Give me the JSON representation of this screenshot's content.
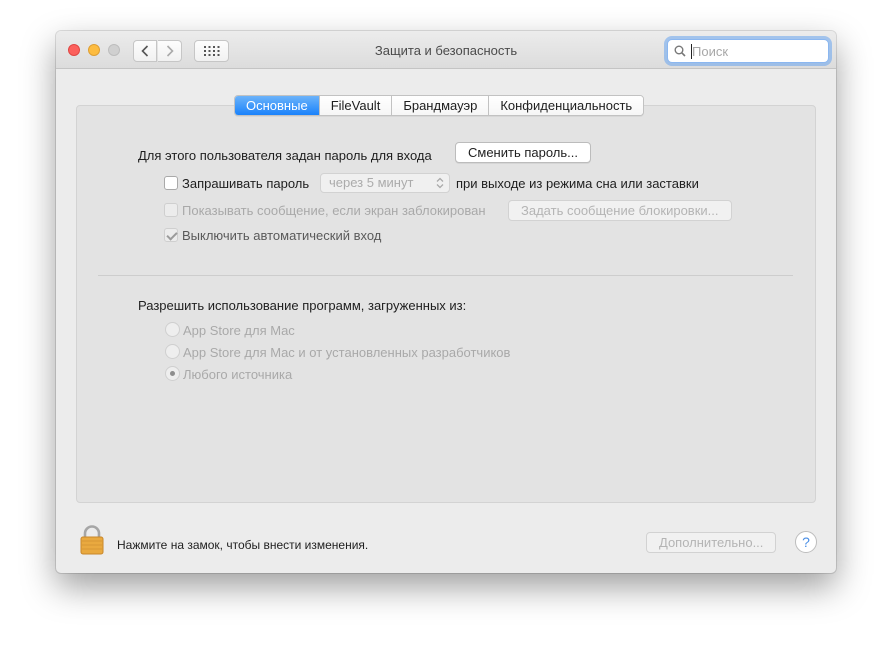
{
  "window": {
    "title": "Защита и безопасность",
    "search_placeholder": "Поиск"
  },
  "tabs": [
    {
      "label": "Основные",
      "active": true
    },
    {
      "label": "FileVault",
      "active": false
    },
    {
      "label": "Брандмауэр",
      "active": false
    },
    {
      "label": "Конфиденциальность",
      "active": false
    }
  ],
  "general": {
    "password_set_label": "Для этого пользователя задан пароль для входа",
    "change_password_button": "Сменить пароль...",
    "require_password": {
      "label": "Запрашивать пароль",
      "checked": false,
      "delay": "через 5 минут",
      "suffix": "при выходе из режима сна или заставки"
    },
    "show_message": {
      "label": "Показывать сообщение, если экран заблокирован",
      "checked": false,
      "disabled": true,
      "button": "Задать сообщение блокировки..."
    },
    "disable_autologin": {
      "label": "Выключить автоматический вход",
      "checked": true,
      "disabled": true
    }
  },
  "allow_apps": {
    "heading": "Разрешить использование программ, загруженных из:",
    "options": [
      {
        "label": "App Store для Mac",
        "selected": false
      },
      {
        "label": "App Store для Mac и от установленных разработчиков",
        "selected": false
      },
      {
        "label": "Любого источника",
        "selected": true
      }
    ]
  },
  "footer": {
    "lock_text": "Нажмите на замок, чтобы внести изменения.",
    "advanced_button": "Дополнительно...",
    "help_label": "?"
  },
  "colors": {
    "accent": "#1a82fb",
    "close": "#fc605c",
    "minimize": "#fdbc40",
    "lock": "#e9a93f"
  }
}
